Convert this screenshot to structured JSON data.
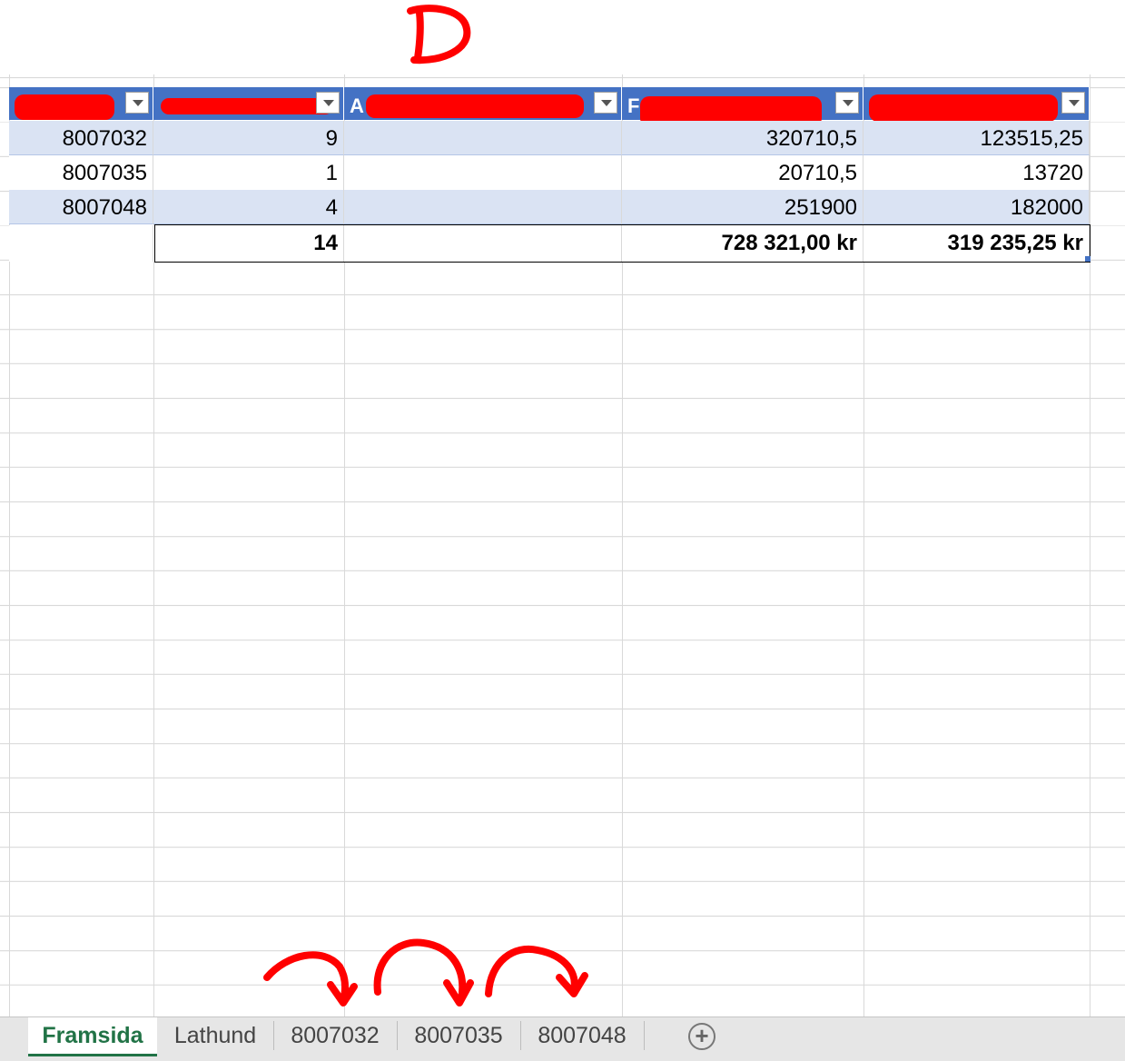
{
  "annotation_letter": "D",
  "table": {
    "headers": [
      {
        "visible_text": "",
        "redacted": true
      },
      {
        "visible_text": "",
        "redacted": true
      },
      {
        "visible_text": "A",
        "redacted": true
      },
      {
        "visible_text": "F",
        "redacted": true
      },
      {
        "visible_text": "",
        "redacted": true
      }
    ],
    "rows": [
      {
        "c1": "8007032",
        "c2": "9",
        "c3": "",
        "c4": "320710,5",
        "c5": "123515,25"
      },
      {
        "c1": "8007035",
        "c2": "1",
        "c3": "",
        "c4": "20710,5",
        "c5": "13720"
      },
      {
        "c1": "8007048",
        "c2": "4",
        "c3": "",
        "c4": "251900",
        "c5": "182000"
      }
    ],
    "totals": {
      "c1": "",
      "c2": "14",
      "c3": "",
      "c4": "728 321,00 kr",
      "c5": "319 235,25 kr"
    }
  },
  "sheet_tabs": [
    "Framsida",
    "Lathund",
    "8007032",
    "8007035",
    "8007048"
  ],
  "active_tab": "Framsida",
  "colors": {
    "header_blue": "#4472c4",
    "band": "#dae3f3",
    "annotation_red": "#ff0000",
    "tab_green": "#217346"
  },
  "icons": {
    "add_sheet": "plus-circle-icon",
    "filter": "dropdown-filter-icon"
  }
}
